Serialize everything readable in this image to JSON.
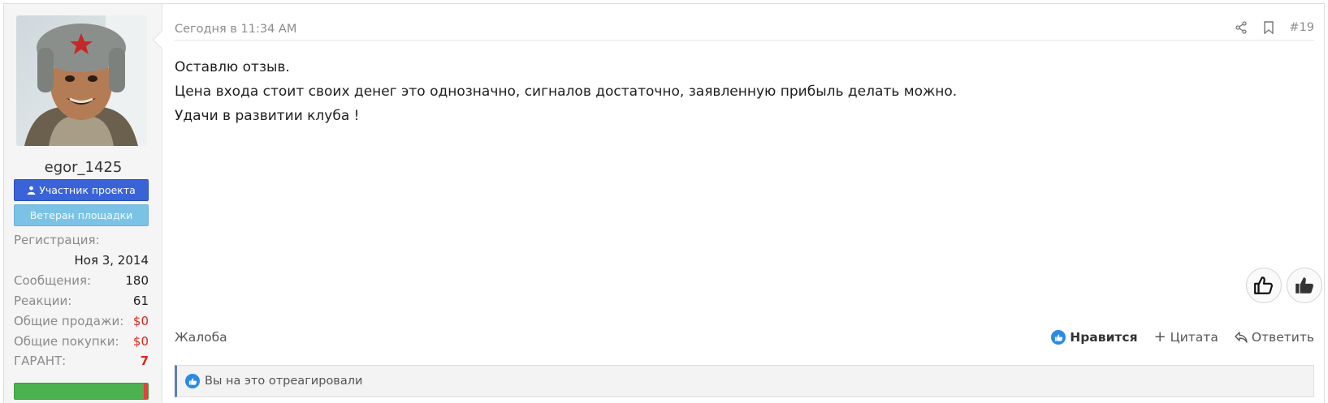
{
  "user": {
    "username": "egor_1425",
    "banners": {
      "member": "Участник проекта",
      "veteran": "Ветеран площадки"
    },
    "info": {
      "registration_label": "Регистрация:",
      "registration_value": "Ноя 3, 2014",
      "messages_label": "Сообщения:",
      "messages_value": "180",
      "reactions_label": "Реакции:",
      "reactions_value": "61",
      "sales_label": "Общие продажи:",
      "sales_value": "$0",
      "purchases_label": "Общие покупки:",
      "purchases_value": "$0",
      "guarant_label": "ГАРАНТ:",
      "guarant_value": "7"
    }
  },
  "post": {
    "date": "Сегодня в 11:34 AM",
    "number": "#19",
    "body": [
      "Оставлю отзыв.",
      "Цена входа стоит своих денег это однозначно, сигналов достаточно, заявленную прибыль делать можно.",
      "Удачи в развитии клуба !"
    ]
  },
  "footer": {
    "report": "Жалоба",
    "like": "Нравится",
    "quote": "Цитата",
    "reply": "Ответить"
  },
  "reactions": {
    "summary": "Вы на это отреагировали"
  },
  "icons": {
    "share": "share-icon",
    "bookmark": "bookmark-icon",
    "like": "thumbs-up-icon",
    "dislike": "thumbs-up-filled-icon"
  },
  "colors": {
    "member_banner": "#3a63d8",
    "veteran_banner": "#7bc3e6",
    "guarant_bar": "#4cb24f",
    "accent_red": "#e0241b",
    "like_blue": "#2b8ae2"
  }
}
